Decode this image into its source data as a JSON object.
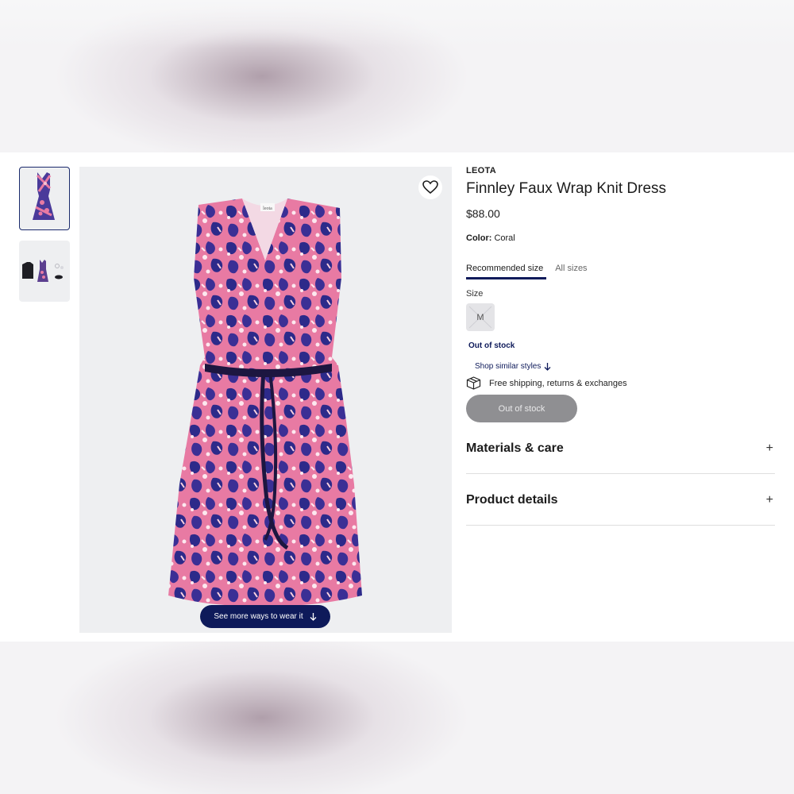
{
  "product": {
    "brand": "LEOTA",
    "title": "Finnley Faux Wrap Knit Dress",
    "price": "$88.00",
    "color_label": "Color:",
    "color_value": "Coral"
  },
  "size_tabs": {
    "recommended": "Recommended size",
    "all": "All sizes"
  },
  "size": {
    "label": "Size",
    "option": "M"
  },
  "stock": {
    "status": "Out of stock",
    "shop_similar": "Shop similar styles",
    "shipping": "Free shipping, returns & exchanges",
    "button": "Out of stock"
  },
  "accordions": [
    {
      "title": "Materials & care",
      "icon": "+"
    },
    {
      "title": "Product details",
      "icon": "+"
    }
  ],
  "gallery": {
    "ways_button": "See more ways to wear it",
    "dress_tag": "leota"
  },
  "colors": {
    "navy": "#0e1a5a",
    "dress_pink": "#e87aa3",
    "dress_purple": "#3a2f8f",
    "disabled_button": "#8f8f92"
  }
}
